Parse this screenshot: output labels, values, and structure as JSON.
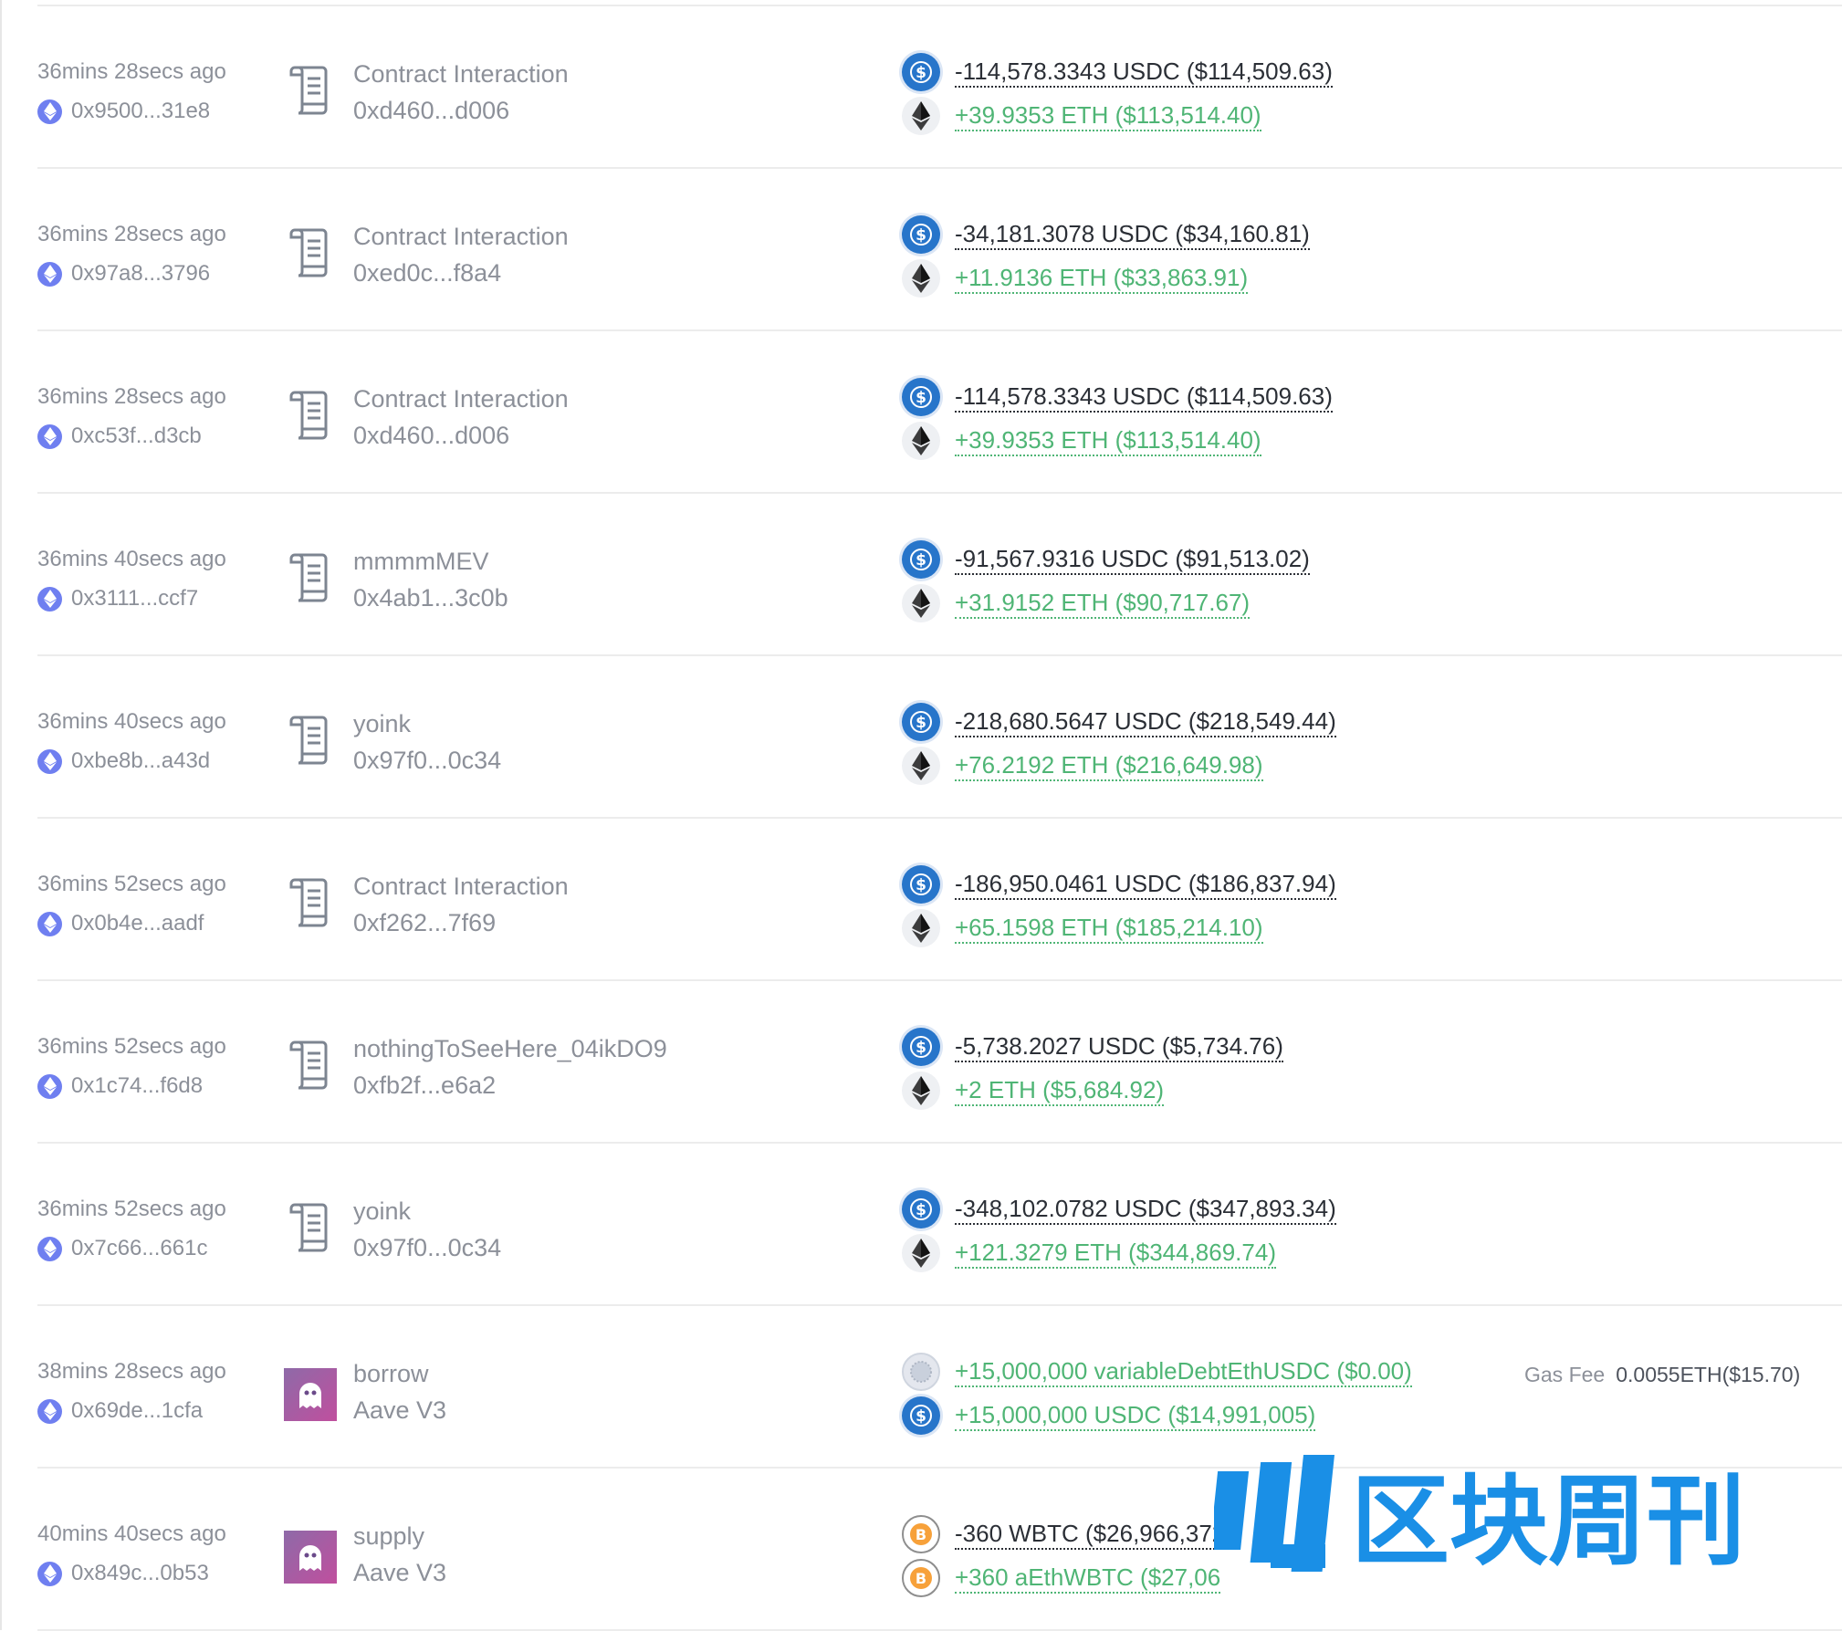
{
  "colors": {
    "usdc": "#2775ca",
    "eth": "#3c3c3d",
    "chain": "#6f7ff0",
    "positive": "#4fb575",
    "negative": "#2b2f36",
    "muted": "#8c9099",
    "watermark": "#1a8fe6"
  },
  "rows": [
    {
      "time": "36mins 28secs ago",
      "hash": "0x9500...31e8",
      "method": "Contract Interaction",
      "target": "0xd460...d006",
      "icon": "contract-scroll-icon",
      "tokens": [
        {
          "sign": "neg",
          "amount": "-114,578.3343 USDC ($114,509.63)",
          "icon": "usdc-icon"
        },
        {
          "sign": "pos",
          "amount": "+39.9353 ETH ($113,514.40)",
          "icon": "eth-icon"
        }
      ]
    },
    {
      "time": "36mins 28secs ago",
      "hash": "0x97a8...3796",
      "method": "Contract Interaction",
      "target": "0xed0c...f8a4",
      "icon": "contract-scroll-icon",
      "tokens": [
        {
          "sign": "neg",
          "amount": "-34,181.3078 USDC ($34,160.81)",
          "icon": "usdc-icon"
        },
        {
          "sign": "pos",
          "amount": "+11.9136 ETH ($33,863.91)",
          "icon": "eth-icon"
        }
      ]
    },
    {
      "time": "36mins 28secs ago",
      "hash": "0xc53f...d3cb",
      "method": "Contract Interaction",
      "target": "0xd460...d006",
      "icon": "contract-scroll-icon",
      "tokens": [
        {
          "sign": "neg",
          "amount": "-114,578.3343 USDC ($114,509.63)",
          "icon": "usdc-icon"
        },
        {
          "sign": "pos",
          "amount": "+39.9353 ETH ($113,514.40)",
          "icon": "eth-icon"
        }
      ]
    },
    {
      "time": "36mins 40secs ago",
      "hash": "0x3111...ccf7",
      "method": "mmmmMEV",
      "target": "0x4ab1...3c0b",
      "icon": "contract-scroll-icon",
      "tokens": [
        {
          "sign": "neg",
          "amount": "-91,567.9316 USDC ($91,513.02)",
          "icon": "usdc-icon"
        },
        {
          "sign": "pos",
          "amount": "+31.9152 ETH ($90,717.67)",
          "icon": "eth-icon"
        }
      ]
    },
    {
      "time": "36mins 40secs ago",
      "hash": "0xbe8b...a43d",
      "method": "yoink",
      "target": "0x97f0...0c34",
      "icon": "contract-scroll-icon",
      "tokens": [
        {
          "sign": "neg",
          "amount": "-218,680.5647 USDC ($218,549.44)",
          "icon": "usdc-icon"
        },
        {
          "sign": "pos",
          "amount": "+76.2192 ETH ($216,649.98)",
          "icon": "eth-icon"
        }
      ]
    },
    {
      "time": "36mins 52secs ago",
      "hash": "0x0b4e...aadf",
      "method": "Contract Interaction",
      "target": "0xf262...7f69",
      "icon": "contract-scroll-icon",
      "tokens": [
        {
          "sign": "neg",
          "amount": "-186,950.0461 USDC ($186,837.94)",
          "icon": "usdc-icon"
        },
        {
          "sign": "pos",
          "amount": "+65.1598 ETH ($185,214.10)",
          "icon": "eth-icon"
        }
      ]
    },
    {
      "time": "36mins 52secs ago",
      "hash": "0x1c74...f6d8",
      "method": "nothingToSeeHere_04ikDO9",
      "target": "0xfb2f...e6a2",
      "icon": "contract-scroll-icon",
      "tokens": [
        {
          "sign": "neg",
          "amount": "-5,738.2027 USDC ($5,734.76)",
          "icon": "usdc-icon"
        },
        {
          "sign": "pos",
          "amount": "+2 ETH ($5,684.92)",
          "icon": "eth-icon"
        }
      ]
    },
    {
      "time": "36mins 52secs ago",
      "hash": "0x7c66...661c",
      "method": "yoink",
      "target": "0x97f0...0c34",
      "icon": "contract-scroll-icon",
      "tokens": [
        {
          "sign": "neg",
          "amount": "-348,102.0782 USDC ($347,893.34)",
          "icon": "usdc-icon"
        },
        {
          "sign": "pos",
          "amount": "+121.3279 ETH ($344,869.74)",
          "icon": "eth-icon"
        }
      ]
    },
    {
      "time": "38mins 28secs ago",
      "hash": "0x69de...1cfa",
      "method": "borrow",
      "target": "Aave V3",
      "icon": "aave-ghost-icon",
      "tokens": [
        {
          "sign": "pos",
          "amount": "+15,000,000 variableDebtEthUSDC ($0.00)",
          "icon": "debt-token-icon"
        },
        {
          "sign": "pos",
          "amount": "+15,000,000 USDC ($14,991,005)",
          "icon": "usdc-icon"
        }
      ],
      "gas_label": "Gas Fee",
      "gas_value": "0.0055ETH($15.70)"
    },
    {
      "time": "40mins 40secs ago",
      "hash": "0x849c...0b53",
      "method": "supply",
      "target": "Aave V3",
      "icon": "aave-ghost-icon",
      "tokens": [
        {
          "sign": "neg",
          "amount": "-360 WBTC ($26,966,372",
          "icon": "wbtc-icon"
        },
        {
          "sign": "pos",
          "amount": "+360 aEthWBTC ($27,06",
          "icon": "wbtc-icon"
        }
      ]
    }
  ],
  "watermark": {
    "text": "区块周刊"
  }
}
